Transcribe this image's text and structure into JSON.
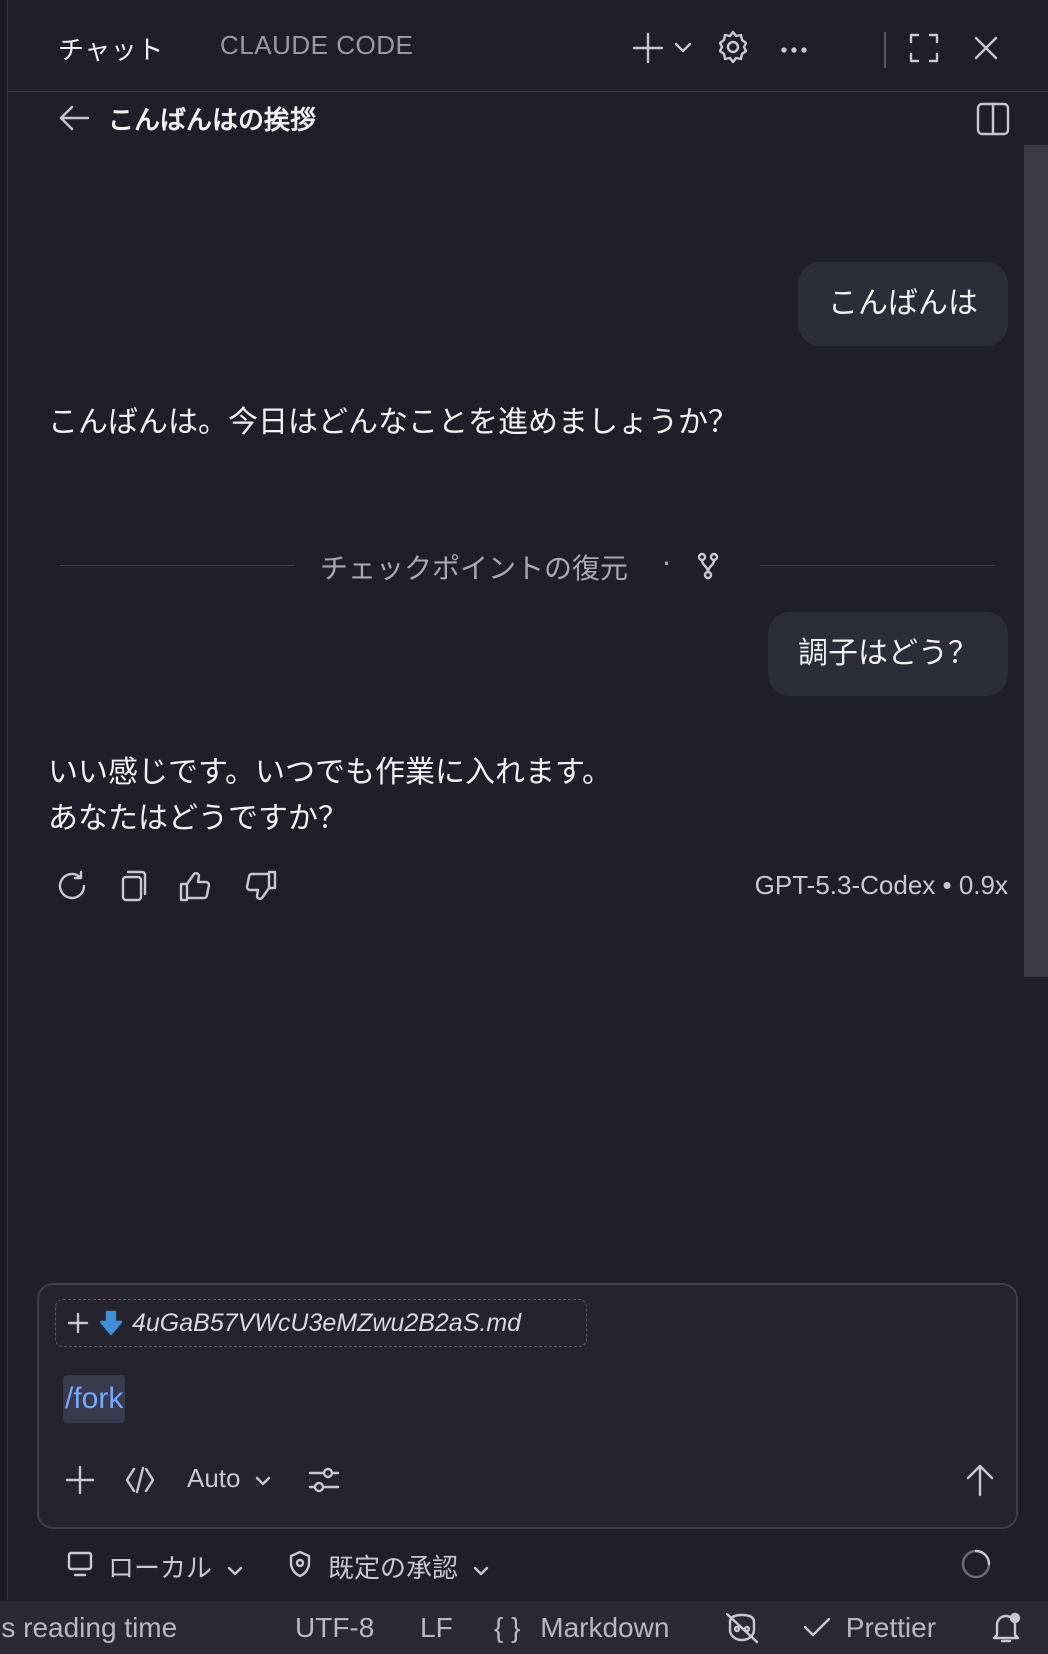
{
  "tabs": {
    "chat": "チャット",
    "claude_code": "CLAUDE CODE"
  },
  "header": {
    "title": "こんばんはの挨拶"
  },
  "messages": [
    {
      "role": "user",
      "text": "こんばんは"
    },
    {
      "role": "assistant",
      "text": "こんばんは。今日はどんなことを進めましょうか？"
    },
    {
      "role": "user",
      "text": "調子はどう？"
    },
    {
      "role": "assistant",
      "line1": "いい感じです。いつでも作業に入れます。",
      "line2": "あなたはどうですか？"
    }
  ],
  "checkpoint": {
    "label": "チェックポイントの復元",
    "separator": "·"
  },
  "response_meta": {
    "model": "GPT-5.3-Codex • 0.9x"
  },
  "composer": {
    "attachment_name": "4uGaB57VWcU3eMZwu2B2aS.md",
    "input_text": "/fork",
    "mode_label": "Auto"
  },
  "subbar": {
    "location_label": "ローカル",
    "approval_label": "既定の承認"
  },
  "statusbar": {
    "reading_time": "'s reading time",
    "encoding": "UTF-8",
    "line_ending": "LF",
    "language_braces": "{ }",
    "language": "Markdown",
    "formatter": "Prettier"
  },
  "colors": {
    "background": "#201f29",
    "bubble": "#2d2c39",
    "accent_link": "#79a8ff",
    "statusbar": "#2a2934"
  },
  "icons": [
    "back-arrow-icon",
    "plus-icon",
    "chevron-down-icon",
    "gear-icon",
    "ellipsis-icon",
    "maximize-icon",
    "close-icon",
    "split-panel-icon",
    "fork-icon",
    "retry-icon",
    "copy-icon",
    "thumbs-up-icon",
    "thumbs-down-icon",
    "download-file-icon",
    "code-icon",
    "sliders-icon",
    "send-arrow-icon",
    "monitor-icon",
    "shield-icon",
    "spinner-icon",
    "copilot-off-icon",
    "check-icon",
    "bell-icon"
  ]
}
